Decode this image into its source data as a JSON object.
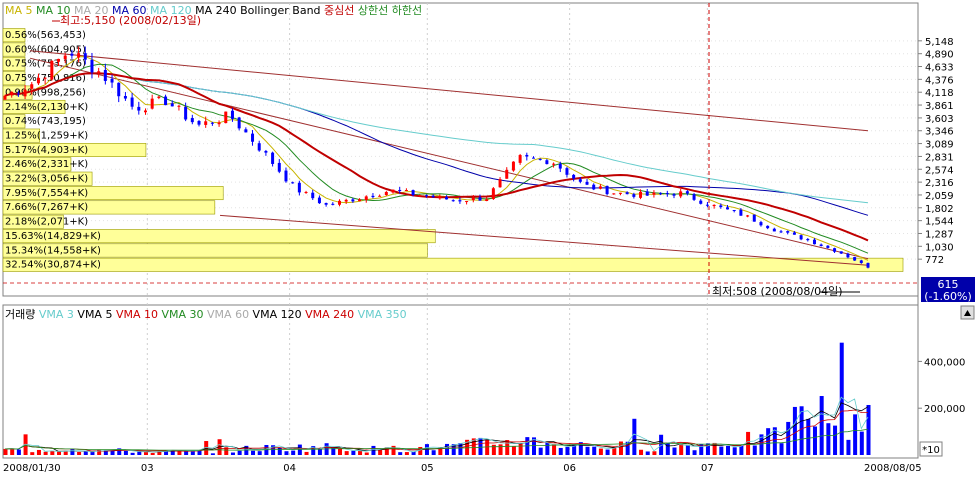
{
  "indicator_legend": {
    "items": [
      {
        "label": "MA 5",
        "color": "#c8b400"
      },
      {
        "label": "MA 10",
        "color": "#228b22"
      },
      {
        "label": "MA 20",
        "color": "#aaaaaa"
      },
      {
        "label": "MA 60",
        "color": "#0000aa"
      },
      {
        "label": "MA 120",
        "color": "#66cccc"
      },
      {
        "label": "MA 240",
        "color": "#000000"
      },
      {
        "label": "Bollinger Band",
        "color": "#000000"
      },
      {
        "label": "중심선",
        "color": "#c00000"
      },
      {
        "label": "상한선",
        "color": "#228b22"
      },
      {
        "label": "하한선",
        "color": "#228b22"
      }
    ]
  },
  "annotations": {
    "high": "최고:5,150 (2008/02/13일)",
    "low": "최저:508 (2008/08/04일)"
  },
  "price_box": {
    "price": "615",
    "change": "(-1.60%)"
  },
  "volume_legend": {
    "items": [
      {
        "label": "거래량",
        "color": "#000000"
      },
      {
        "label": "VMA 3",
        "color": "#66cccc"
      },
      {
        "label": "VMA 5",
        "color": "#000000"
      },
      {
        "label": "VMA 10",
        "color": "#cc0000"
      },
      {
        "label": "VMA 30",
        "color": "#228b22"
      },
      {
        "label": "VMA 60",
        "color": "#aaaaaa"
      },
      {
        "label": "VMA 120",
        "color": "#000000"
      },
      {
        "label": "VMA 240",
        "color": "#cc0000"
      },
      {
        "label": "VMA 350",
        "color": "#66cccc"
      }
    ]
  },
  "volume_multiplier": "*10",
  "colors": {
    "up": "#ff0000",
    "down": "#0000ff",
    "profile": "#ffff99",
    "profile_border": "#999900",
    "price_box": "#0000aa"
  },
  "chart_data": [
    {
      "type": "candlestick",
      "title": "",
      "x_ticks": [
        "2008/01/30",
        "03",
        "04",
        "05",
        "06",
        "07",
        "2008/08/05"
      ],
      "y_ticks": [
        "5,148",
        "4,890",
        "4,633",
        "4,376",
        "4,118",
        "3,861",
        "3,603",
        "3,346",
        "3,089",
        "2,831",
        "2,574",
        "2,316",
        "2,059",
        "1,802",
        "1,544",
        "1,287",
        "1,030",
        "772"
      ],
      "ylim": [
        515,
        5405
      ],
      "close_path": [
        [
          "2008/01/30",
          4050
        ],
        [
          "2008/02/05",
          4300
        ],
        [
          "2008/02/13",
          4950
        ],
        [
          "2008/02/20",
          4500
        ],
        [
          "2008/02/27",
          3800
        ],
        [
          "2008/03/05",
          3950
        ],
        [
          "2008/03/12",
          3450
        ],
        [
          "2008/03/19",
          3650
        ],
        [
          "2008/03/26",
          2950
        ],
        [
          "2008/04/02",
          2200
        ],
        [
          "2008/04/09",
          1850
        ],
        [
          "2008/04/16",
          2000
        ],
        [
          "2008/04/23",
          2150
        ],
        [
          "2008/04/30",
          2050
        ],
        [
          "2008/05/07",
          1950
        ],
        [
          "2008/05/14",
          2000
        ],
        [
          "2008/05/21",
          2800
        ],
        [
          "2008/05/28",
          2750
        ],
        [
          "2008/06/04",
          2250
        ],
        [
          "2008/06/11",
          2100
        ],
        [
          "2008/06/18",
          2050
        ],
        [
          "2008/06/25",
          2100
        ],
        [
          "2008/07/02",
          1850
        ],
        [
          "2008/07/09",
          1650
        ],
        [
          "2008/07/16",
          1350
        ],
        [
          "2008/07/23",
          1150
        ],
        [
          "2008/07/30",
          900
        ],
        [
          "2008/08/05",
          615
        ]
      ],
      "series": [
        {
          "name": "MA 5",
          "color": "#c8b400"
        },
        {
          "name": "MA 10",
          "color": "#228b22"
        },
        {
          "name": "MA 60",
          "color": "#0000aa"
        },
        {
          "name": "MA 120",
          "color": "#66cccc"
        },
        {
          "name": "중심선",
          "color": "#c00000"
        }
      ],
      "volume_profile": [
        {
          "label": "0.56%(563,453)",
          "value": 563453
        },
        {
          "label": "0.60%(604,905)",
          "value": 604905
        },
        {
          "label": "0.75%(753,176)",
          "value": 753176
        },
        {
          "label": "0.75%(750,816)",
          "value": 750816
        },
        {
          "label": "0.99%(998,256)",
          "value": 998256
        },
        {
          "label": "2.14%(2,130+K)",
          "value": 2130000
        },
        {
          "label": "0.74%(743,195)",
          "value": 743195
        },
        {
          "label": "1.25%(1,259+K)",
          "value": 1259000
        },
        {
          "label": "5.17%(4,903+K)",
          "value": 4903000
        },
        {
          "label": "2.46%(2,331+K)",
          "value": 2331000
        },
        {
          "label": "3.22%(3,056+K)",
          "value": 3056000
        },
        {
          "label": "7.95%(7,554+K)",
          "value": 7554000
        },
        {
          "label": "7.66%(7,267+K)",
          "value": 7267000
        },
        {
          "label": "2.18%(2,071+K)",
          "value": 2071000
        },
        {
          "label": "15.63%(14,829+K)",
          "value": 14829000
        },
        {
          "label": "15.34%(14,558+K)",
          "value": 14558000
        },
        {
          "label": "32.54%(30,874+K)",
          "value": 30874000
        }
      ]
    },
    {
      "type": "bar",
      "title": "",
      "y_ticks": [
        "400,000",
        "200,000"
      ],
      "ylim": [
        0,
        500000
      ],
      "volume_profile_path": [
        [
          "2008/01/30",
          20000
        ],
        [
          "2008/02/13",
          26000
        ],
        [
          "2008/02/27",
          16000
        ],
        [
          "2008/03/12",
          14000
        ],
        [
          "2008/03/26",
          30000
        ],
        [
          "2008/04/09",
          34000
        ],
        [
          "2008/04/23",
          22000
        ],
        [
          "2008/05/07",
          38000
        ],
        [
          "2008/05/21",
          64000
        ],
        [
          "2008/06/04",
          40000
        ],
        [
          "2008/06/18",
          36000
        ],
        [
          "2008/07/02",
          48000
        ],
        [
          "2008/07/16",
          76000
        ],
        [
          "2008/07/23",
          190000
        ],
        [
          "2008/07/30",
          150000
        ],
        [
          "2008/08/05",
          180000
        ]
      ]
    }
  ]
}
